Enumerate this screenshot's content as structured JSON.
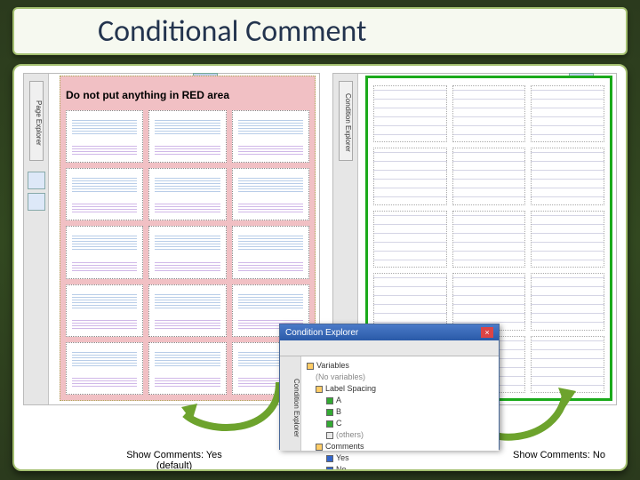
{
  "title": "Conditional Comment",
  "left_panel": {
    "side_tab": "Page Explorer",
    "warning": "Do not put anything in RED area"
  },
  "right_panel": {
    "side_tab": "Condition Explorer"
  },
  "cond_window": {
    "title": "Condition Explorer",
    "side_tab": "Condition Explorer",
    "tree": {
      "root": "Variables",
      "no_vars": "(No variables)",
      "group": "Label Spacing",
      "items": [
        "A",
        "B",
        "C",
        "(others)"
      ],
      "group2": "Comments",
      "items2": [
        "Yes",
        "No"
      ]
    }
  },
  "captions": {
    "left_line1": "Show Comments: Yes",
    "left_line2": "(default)",
    "right": "Show Comments: No"
  }
}
